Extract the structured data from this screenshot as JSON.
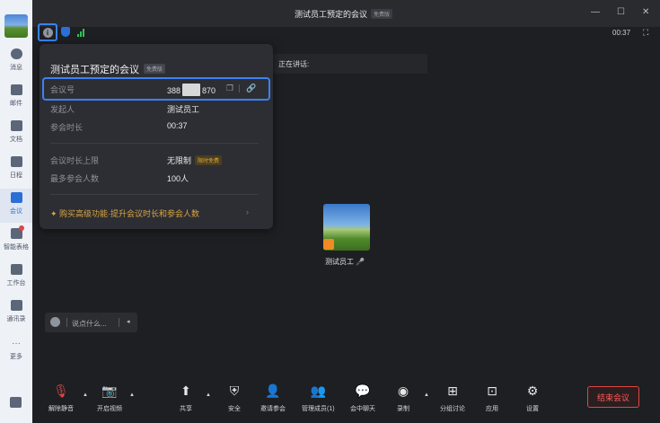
{
  "window": {
    "title": "测试员工预定的会议",
    "title_badge": "免费版",
    "minimize": "—",
    "maximize": "☐",
    "close": "✕"
  },
  "infobar": {
    "timer": "00:37",
    "fullscreen": "⛶"
  },
  "sidebar": {
    "items": [
      {
        "label": "消息"
      },
      {
        "label": "邮件"
      },
      {
        "label": "文档"
      },
      {
        "label": "日程"
      },
      {
        "label": "会议"
      },
      {
        "label": "智能表格"
      },
      {
        "label": "工作台"
      },
      {
        "label": "通讯录"
      },
      {
        "label": "更多"
      }
    ],
    "more_dots": "···"
  },
  "panel": {
    "title": "测试员工预定的会议",
    "title_badge": "免费版",
    "meeting_id_label": "会议号",
    "meeting_id_prefix": "388",
    "meeting_id_suffix": "870",
    "host_label": "发起人",
    "host_value": "测试员工",
    "duration_label": "参会时长",
    "duration_value": "00:37",
    "limit_label": "会议时长上限",
    "limit_value": "无限制",
    "limit_badge": "限时免费",
    "max_label": "最多参会人数",
    "max_value": "100人",
    "upgrade_text": "购买高级功能·提升会议时长和参会人数",
    "upgrade_chevron": "›"
  },
  "speaking": {
    "label": "正在讲话:"
  },
  "participant": {
    "name": "测试员工"
  },
  "chat": {
    "placeholder": "说点什么..."
  },
  "toolbar": {
    "items": [
      {
        "label": "解除静音"
      },
      {
        "label": "开启视频"
      },
      {
        "label": "共享"
      },
      {
        "label": "安全"
      },
      {
        "label": "邀请参会"
      },
      {
        "label": "管理成员(1)"
      },
      {
        "label": "会中聊天"
      },
      {
        "label": "录制"
      },
      {
        "label": "分组讨论"
      },
      {
        "label": "应用"
      },
      {
        "label": "设置"
      }
    ],
    "end_label": "结束会议"
  },
  "colors": {
    "accent": "#2b6fd6",
    "highlight_border": "#3b82f6",
    "end_red": "#e04545",
    "gold": "#d9a441",
    "signal_green": "#2ec35b"
  }
}
